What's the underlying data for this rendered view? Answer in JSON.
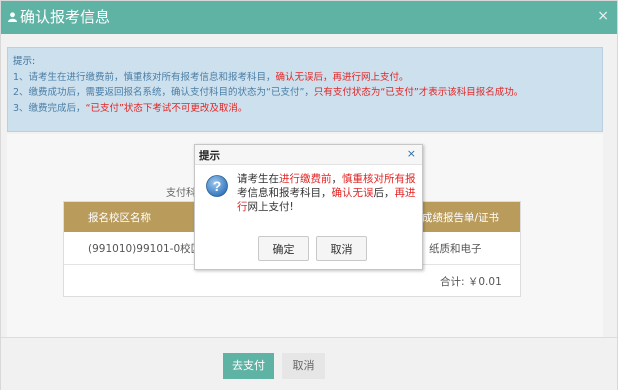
{
  "window": {
    "title": "确认报考信息",
    "close": "×",
    "accent": "#5fb3a5"
  },
  "notice": {
    "title": "提示:",
    "line1": {
      "prefix": "1、请考生在进行缴费前，慎重核对所有报考信息和报考科目，",
      "red": "确认无误后，再进行网上支付。"
    },
    "line2": {
      "prefix": "2、缴费成功后，需要返回报名系统，确认支付科目的状态为“已支付”，",
      "red": "只有支付状态为“已支付”才表示该科目报名成功。"
    },
    "line3": {
      "prefix": "3、缴费完成后，",
      "red": "“已支付”状态下考试不可更改及取消。"
    }
  },
  "form": {
    "pay_label": "支付科"
  },
  "table": {
    "headers": {
      "campus": "报名校区名称",
      "cert": "成绩报告单/证书"
    },
    "row": {
      "campus": "(991010)99101-0校区",
      "cert": "纸质和电子"
    },
    "total": "合计: ￥0.01",
    "header_color": "#b99c5c"
  },
  "footer": {
    "pay_button": "去支付",
    "cancel_button": "取消"
  },
  "dialog": {
    "title": "提示",
    "close": "×",
    "msg": {
      "p1": "请考生在",
      "r1": "进行缴费前",
      "p2": "，",
      "r2": "慎重核对所有报",
      "p3": "考信息和报考科目，",
      "r3": "确认无误",
      "p4": "后，",
      "r4": "再进行",
      "p5": "网上支付!"
    },
    "ok": "确定",
    "cancel": "取消"
  }
}
